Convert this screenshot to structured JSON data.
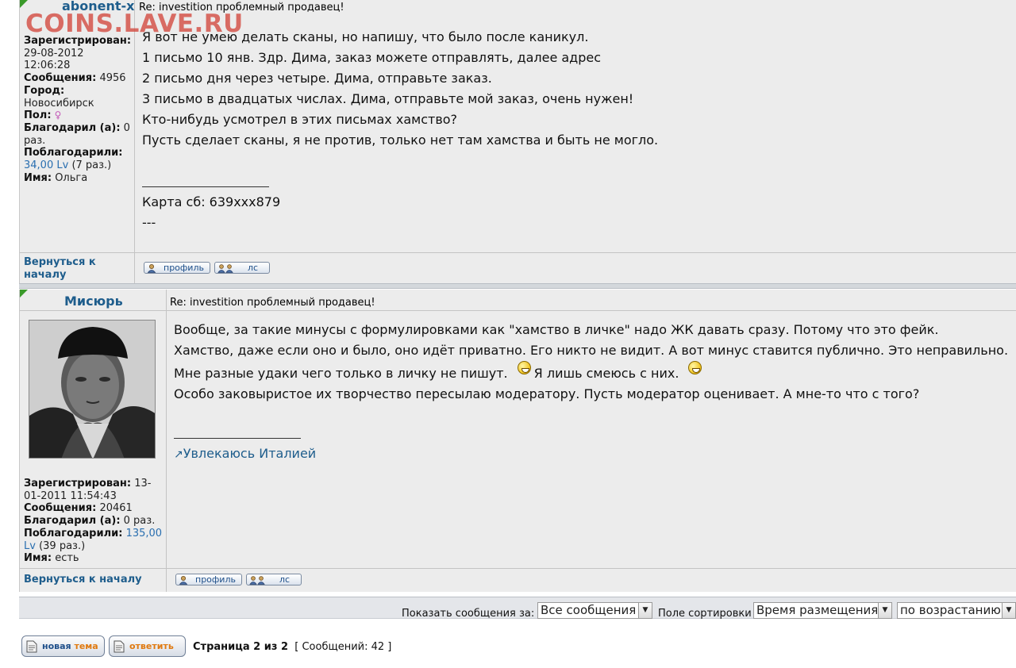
{
  "watermark": "COINS.LAVE.RU",
  "posts": [
    {
      "author": "abonent-x",
      "subject": "Re: investition проблемный продавец!",
      "info": {
        "registered_label": "Зарегистрирован:",
        "registered_value_1": "29-08-2012",
        "registered_value_2": "12:06:28",
        "messages_label": "Сообщения:",
        "messages_value": "4956",
        "city_label": "Город:",
        "city_value": "Новосибирск",
        "gender_label": "Пол:",
        "gender_icon": "female-icon",
        "thanked_label": "Благодарил (а):",
        "thanked_value_1": "0",
        "thanked_value_2": "раз.",
        "thanked_by_label": "Поблагодарили:",
        "thanked_by_amount": "34,00 Lv",
        "thanked_by_count": "(7 раз.)",
        "name_label": "Имя:",
        "name_value": "Ольга"
      },
      "lines": [
        "Я вот не умею делать сканы, но напишу, что было после каникул.",
        "1 письмо 10 янв. Здр. Дима, заказ можете отправлять, далее адрес",
        "2 письмо дня через четыре. Дима, отправьте заказ.",
        "3 письмо в двадцатых числах. Дима, отправьте мой заказ, очень нужен!",
        "Кто-нибудь усмотрел в этих письмах хамство?",
        "Пусть сделает сканы, я не против, только нет там хамства и быть не могло."
      ],
      "signature": [
        "Карта сб: 639xxx879",
        "---"
      ],
      "back_line1": "Вернуться к",
      "back_line2": "началу",
      "profile_label": "профиль",
      "pm_label": "лс"
    },
    {
      "author": "Мисюрь",
      "subject": "Re: investition проблемный продавец!",
      "info": {
        "registered_label": "Зарегистрирован:",
        "registered_value_1": "13-",
        "registered_value_2": "01-2011 11:54:43",
        "messages_label": "Сообщения:",
        "messages_value": "20461",
        "thanked_label": "Благодарил (а):",
        "thanked_value": "0 раз.",
        "thanked_by_label": "Поблагодарили:",
        "thanked_by_amount_1": "135,00",
        "thanked_by_amount_2": "Lv",
        "thanked_by_count": "(39 раз.)",
        "name_label": "Имя:",
        "name_value": "есть"
      },
      "lines": [
        "Вообще, за такие минусы с формулировками как \"хамство в личке\" надо ЖК давать сразу. Потому что это фейк.",
        "Хамство, даже если оно и было, оно идёт приватно. Его никто не видит. А вот минус ставится публично. Это неправильно.",
        "Мне разные удаки чего только в личку не пишут.",
        "Я лишь смеюсь с них.",
        "Особо заковыристое их творчество пересылаю модератору. Пусть модератор оценивает. А мне-то что с того?"
      ],
      "signature_link": "Увлекаюсь Италией",
      "back_label": "Вернуться к началу",
      "profile_label": "профиль",
      "pm_label": "лс"
    }
  ],
  "footer": {
    "show_label": "Показать сообщения за:",
    "show_value": "Все сообщения",
    "sort_label": "Поле сортировки",
    "sort_value": "Время размещения",
    "order_value": "по возрастанию"
  },
  "bottom": {
    "new_topic_1": "новая",
    "new_topic_2": "тема",
    "reply": "ответить",
    "page_info": "Страница 2 из 2",
    "messages_count": "[ Сообщений: 42 ]"
  },
  "colors": {
    "link": "#1e5d8c",
    "watermark": "#d2463c",
    "post_bg": "#ececec",
    "corner_green": "#3a9a2a"
  }
}
